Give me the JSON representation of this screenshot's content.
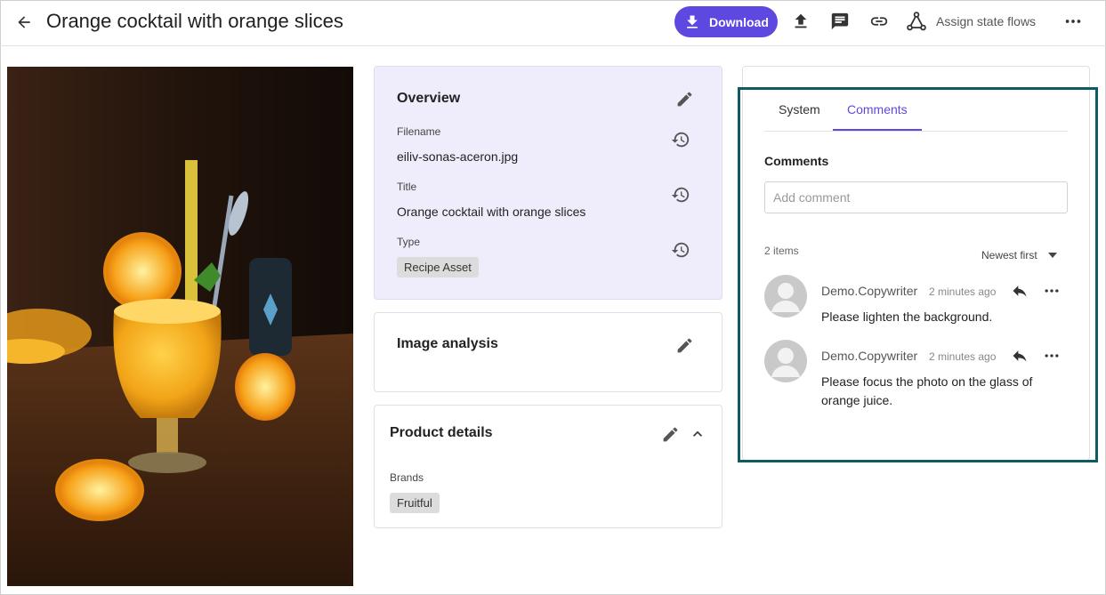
{
  "header": {
    "title": "Orange cocktail with orange slices",
    "download_label": "Download",
    "assign_label": "Assign state flows"
  },
  "overview": {
    "title": "Overview",
    "filename_label": "Filename",
    "filename_value": "eiliv-sonas-aceron.jpg",
    "title_label": "Title",
    "title_value": "Orange cocktail with orange slices",
    "type_label": "Type",
    "type_value": "Recipe Asset"
  },
  "image_analysis": {
    "title": "Image analysis"
  },
  "product_details": {
    "title": "Product details",
    "brands_label": "Brands",
    "brands_value": "Fruitful"
  },
  "side_panel": {
    "tabs": [
      {
        "label": "System",
        "active": false
      },
      {
        "label": "Comments",
        "active": true
      }
    ],
    "section_title": "Comments",
    "input_placeholder": "Add comment",
    "count_label": "2 items",
    "sort_label": "Newest first",
    "comments": [
      {
        "author": "Demo.Copywriter",
        "time": "2 minutes ago",
        "text": "Please lighten the background."
      },
      {
        "author": "Demo.Copywriter",
        "time": "2 minutes ago",
        "text": "Please focus the photo on the glass of orange juice."
      }
    ]
  },
  "colors": {
    "accent": "#5e49e0",
    "overview_bg": "#efedfb",
    "highlight_border": "#0f5a63"
  },
  "icons": {
    "back": "arrow-left-icon",
    "download": "download-icon",
    "upload": "upload-icon",
    "comment": "comment-icon",
    "link": "link-icon",
    "workflow": "workflow-icon",
    "more": "more-horizontal-icon",
    "edit": "pencil-icon",
    "history": "history-icon",
    "collapse": "chevron-up-icon",
    "sort": "caret-down-icon",
    "reply": "reply-icon"
  }
}
